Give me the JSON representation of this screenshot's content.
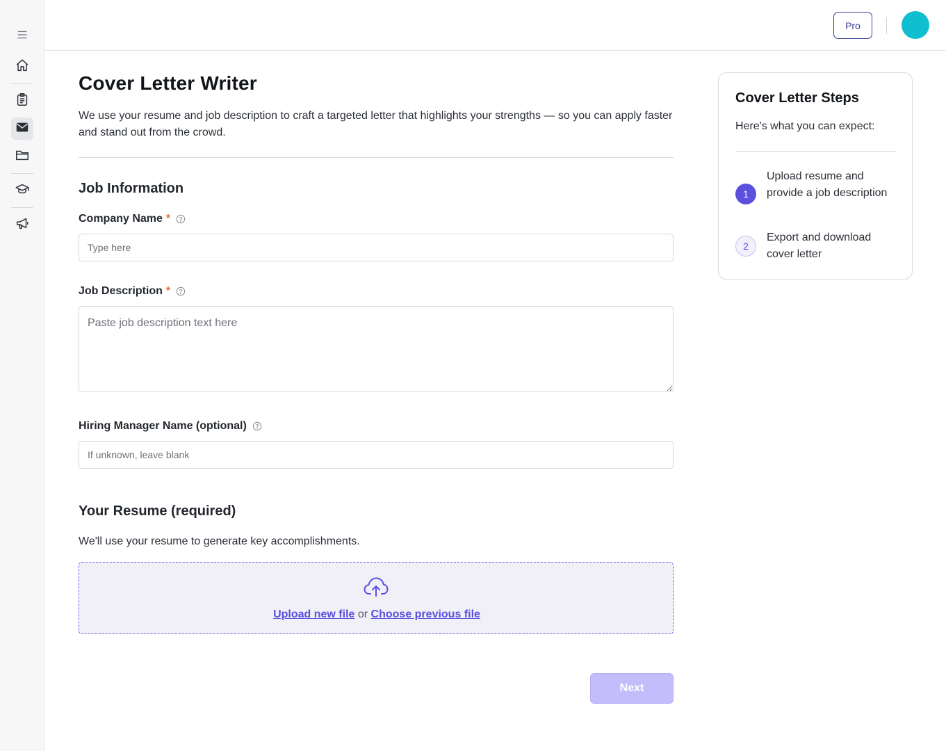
{
  "sidebar": {
    "items": [
      {
        "icon": "menu-icon"
      },
      {
        "icon": "home-icon"
      },
      {
        "icon": "clipboard-icon"
      },
      {
        "icon": "mail-icon",
        "active": true
      },
      {
        "icon": "folder-icon"
      },
      {
        "icon": "graduation-cap-icon"
      },
      {
        "icon": "megaphone-icon"
      }
    ]
  },
  "header": {
    "pro_label": "Pro",
    "avatar_color": "#0fbfd0"
  },
  "main": {
    "title": "Cover Letter Writer",
    "description": "We use your resume and job description to craft a targeted letter that highlights your strengths — so you can apply faster and stand out from the crowd.",
    "job_section_title": "Job Information",
    "company": {
      "label": "Company Name",
      "required_mark": "*",
      "placeholder": "Type here",
      "value": ""
    },
    "job_description": {
      "label": "Job Description",
      "required_mark": "*",
      "placeholder": "Paste job description text here",
      "value": ""
    },
    "hiring_manager": {
      "label": "Hiring Manager Name (optional)",
      "placeholder": "If unknown, leave blank",
      "value": ""
    },
    "resume": {
      "title": "Your Resume (required)",
      "description": "We'll use your resume to generate key accomplishments.",
      "upload_link": "Upload new file",
      "or_text": "or",
      "previous_link": "Choose previous file"
    },
    "next_label": "Next"
  },
  "steps": {
    "title": "Cover Letter Steps",
    "subtitle": "Here's what you can expect:",
    "items": [
      {
        "number": "1",
        "text": "Upload resume and provide a job description",
        "active": true
      },
      {
        "number": "2",
        "text": "Export and download cover letter",
        "active": false
      }
    ]
  },
  "colors": {
    "accent": "#5b4fe0",
    "next_disabled": "#c3bdfb",
    "required": "#e8712e"
  }
}
